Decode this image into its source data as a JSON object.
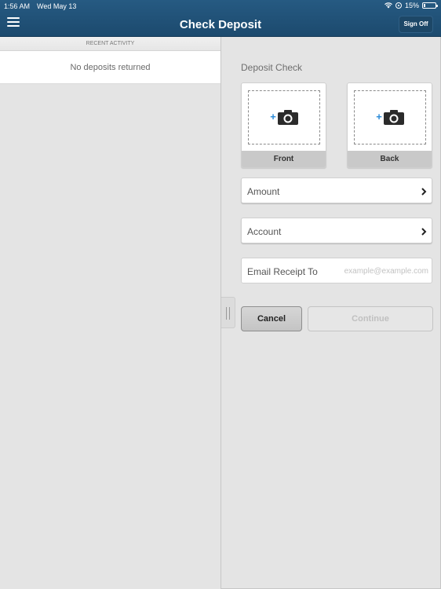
{
  "status_bar": {
    "time": "1:56 AM",
    "date": "Wed May 13",
    "battery": "15%",
    "icons": [
      "wifi-icon",
      "rotation-lock-icon",
      "battery-icon"
    ]
  },
  "header": {
    "title": "Check Deposit",
    "menu_icon": "hamburger-menu-icon",
    "sign_off_label": "Sign Off"
  },
  "recent_activity": {
    "section_title": "RECENT ACTIVITY",
    "empty_message": "No deposits returned"
  },
  "deposit": {
    "title": "Deposit Check",
    "front_label": "Front",
    "back_label": "Back",
    "capture_icon": "add-photo-camera-icon",
    "amount_label": "Amount",
    "account_label": "Account",
    "email_label": "Email Receipt To",
    "email_value": "",
    "email_placeholder": "example@example.com",
    "cancel_label": "Cancel",
    "continue_label": "Continue",
    "continue_enabled": false
  },
  "colors": {
    "header_blue": "#1f4f75",
    "accent_blue": "#2a8ad8",
    "background": "#e4e4e4"
  }
}
